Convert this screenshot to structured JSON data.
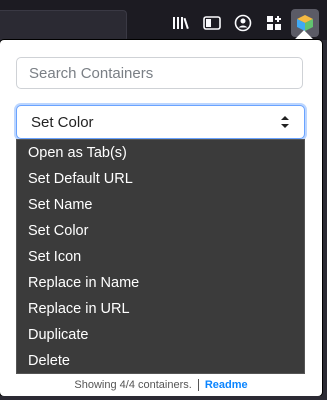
{
  "toolbar": {
    "icons": [
      "library-icon",
      "sidebar-icon",
      "account-icon",
      "extensions-icon",
      "containers-extension-icon"
    ]
  },
  "panel": {
    "search": {
      "placeholder": "Search Containers",
      "value": ""
    },
    "select": {
      "selected": "Set Color"
    },
    "menu_items": [
      "Open as Tab(s)",
      "Set Default URL",
      "Set Name",
      "Set Color",
      "Set Icon",
      "Replace in Name",
      "Replace in URL",
      "Duplicate",
      "Delete"
    ],
    "footer": {
      "count_text": "Showing 4/4 containers.",
      "link": "Readme"
    }
  },
  "colors": {
    "accent": "#0a84ff",
    "menu_bg": "#3b3b3b",
    "toolbar_bg": "#1c1b22"
  }
}
